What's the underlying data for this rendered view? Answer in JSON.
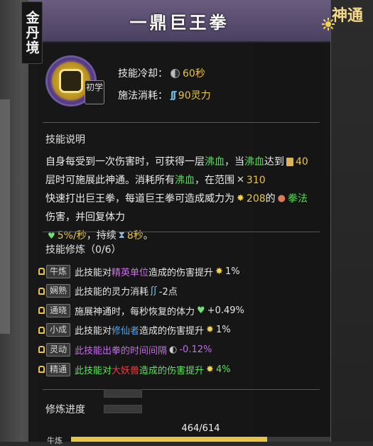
{
  "header": {
    "title": "一鼎巨王拳",
    "realm": "金丹境",
    "logo_text": "神通"
  },
  "skill": {
    "grade": "初学",
    "cooldown_label": "技能冷却：",
    "cooldown_value": "60秒",
    "cost_label": "施法消耗：",
    "cost_value": "90灵力"
  },
  "description": {
    "title": "技能说明",
    "t1": "自身每受到一次伤害时，可获得一层",
    "k1": "沸血",
    "t2": "，当",
    "k2": "沸血",
    "t3": "达到",
    "v1": "40",
    "t4": "层时可施展此神通。消耗所有",
    "k3": "沸血",
    "t5": "，在范围",
    "v2": "310",
    "t6": "快速打出巨王拳，每道巨王拳可造成威力为",
    "v3": "208",
    "t7": "的",
    "k4": "拳法",
    "t8": "伤害，并回复体力",
    "v4": "5%/秒",
    "t9": "，持续",
    "v5": "8秒",
    "t10": "。"
  },
  "modifications": {
    "title": "技能修炼（0/6）",
    "rows": [
      {
        "tag": "牛炼",
        "pre": "此技能对",
        "key": "精英单位",
        "post": "造成的伤害提升",
        "value": "1%",
        "icon": "sun-icon",
        "key_color": "#cc6ee8"
      },
      {
        "tag": "娴熟",
        "pre": "此技能的灵力消耗",
        "key": "",
        "post": "",
        "value": "-2点",
        "icon": "wave-icon",
        "key_color": ""
      },
      {
        "tag": "通晓",
        "pre": "施展神通时，每秒恢复的体力",
        "key": "",
        "post": "",
        "value": "+0.49%",
        "icon": "heal-icon",
        "key_color": ""
      },
      {
        "tag": "小成",
        "pre": "此技能对",
        "key": "修仙者",
        "post": "造成的伤害提升",
        "value": "1%",
        "icon": "sun-icon",
        "key_color": "#55a5f0"
      },
      {
        "tag": "灵动",
        "pre": "此技能出拳的时间间隔",
        "key": "",
        "post": "",
        "value": "-0.12%",
        "icon": "moon-icon",
        "key_color": ""
      },
      {
        "tag": "精通",
        "pre": "此技能对",
        "key": "大妖兽",
        "post": "造成的伤害提升",
        "value": "4%",
        "icon": "sun-icon",
        "key_color": "#e94040"
      }
    ]
  },
  "progress": {
    "label": "修炼进度",
    "text": "464/614",
    "current": 464,
    "max": 614,
    "bottom_tag": "牛炼"
  },
  "colors": {
    "accent_gold": "#e8c548",
    "title_bar": "#5a4f72",
    "keyword_green": "#58d65a"
  }
}
